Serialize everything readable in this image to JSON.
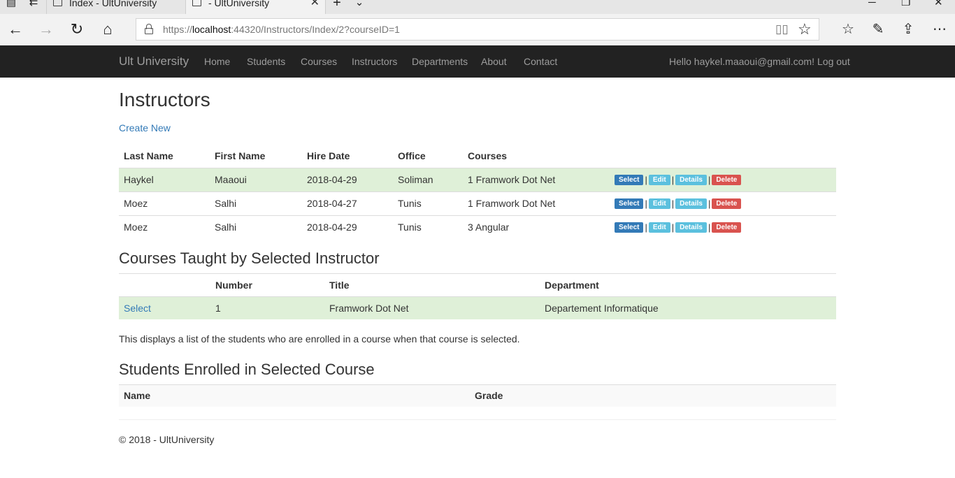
{
  "browser": {
    "tabs": [
      {
        "title": "Index - UltUniversity",
        "active": false
      },
      {
        "title": "- UltUniversity",
        "active": true
      }
    ],
    "url_scheme": "https://",
    "url_host": "localhost",
    "url_rest": ":44320/Instructors/Index/2?courseID=1"
  },
  "navbar": {
    "brand": "Ult University",
    "links": [
      "Home",
      "Students",
      "Courses",
      "Instructors",
      "Departments",
      "About",
      "Contact"
    ],
    "greeting": "Hello haykel.maaoui@gmail.com!",
    "logout": "Log out"
  },
  "page": {
    "title": "Instructors",
    "create_new": "Create New"
  },
  "instructors": {
    "columns": [
      "Last Name",
      "First Name",
      "Hire Date",
      "Office",
      "Courses"
    ],
    "actions": {
      "select": "Select",
      "edit": "Edit",
      "details": "Details",
      "delete": "Delete",
      "separator": "|"
    },
    "rows": [
      {
        "last": "Haykel",
        "first": "Maaoui",
        "hire": "2018-04-29",
        "office": "Soliman",
        "courses": "1 Framwork Dot Net",
        "selected": true
      },
      {
        "last": "Moez",
        "first": "Salhi",
        "hire": "2018-04-27",
        "office": "Tunis",
        "courses": "1 Framwork Dot Net",
        "selected": false
      },
      {
        "last": "Moez",
        "first": "Salhi",
        "hire": "2018-04-29",
        "office": "Tunis",
        "courses": "3 Angular",
        "selected": false
      }
    ]
  },
  "courses_section": {
    "heading": "Courses Taught by Selected Instructor",
    "columns": [
      "",
      "Number",
      "Title",
      "Department"
    ],
    "rows": [
      {
        "action": "Select",
        "number": "1",
        "title": "Framwork Dot Net",
        "department": "Departement Informatique"
      }
    ],
    "note": "This displays a list of the students who are enrolled in a course when that course is selected."
  },
  "students_section": {
    "heading": "Students Enrolled in Selected Course",
    "columns": [
      "Name",
      "Grade"
    ]
  },
  "footer": {
    "text": "© 2018 - UltUniversity"
  },
  "colors": {
    "navbar_bg": "#222222",
    "selected_row": "#dff0d8",
    "primary": "#337ab7",
    "info": "#5bc0de",
    "danger": "#d9534f"
  }
}
